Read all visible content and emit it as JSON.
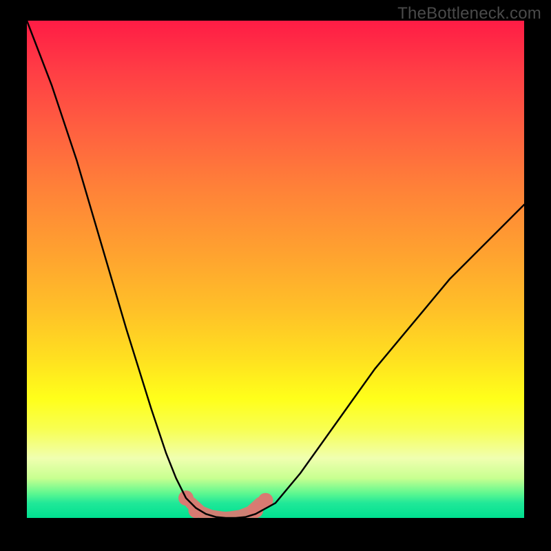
{
  "watermark": "TheBottleneck.com",
  "chart_data": {
    "type": "line",
    "title": "",
    "xlabel": "",
    "ylabel": "",
    "xlim": [
      0,
      100
    ],
    "ylim": [
      0,
      100
    ],
    "grid": false,
    "legend": false,
    "background_gradient": {
      "top": "#ff1c45",
      "mid": "#ffe020",
      "bottom": "#00e090"
    },
    "series": [
      {
        "name": "bottleneck-curve",
        "x": [
          0,
          5,
          10,
          15,
          20,
          25,
          28,
          30,
          32,
          34,
          36,
          38,
          40,
          42,
          44,
          46,
          50,
          55,
          60,
          65,
          70,
          75,
          80,
          85,
          90,
          95,
          100
        ],
        "values": [
          100,
          87,
          72,
          55,
          38,
          22,
          13,
          8,
          4,
          2,
          0.8,
          0.2,
          0,
          0,
          0.2,
          0.8,
          3,
          9,
          16,
          23,
          30,
          36,
          42,
          48,
          53,
          58,
          63
        ]
      },
      {
        "name": "ideal-range",
        "x": [
          33,
          35,
          37,
          39,
          40,
          41,
          43,
          45,
          47
        ],
        "values": [
          3,
          1.2,
          0.4,
          0.1,
          0,
          0.1,
          0.4,
          1.2,
          3
        ]
      }
    ],
    "annotations": [
      {
        "name": "marker-left-1",
        "x": 32,
        "y": 4
      },
      {
        "name": "marker-left-2",
        "x": 34,
        "y": 1.5
      },
      {
        "name": "marker-right-1",
        "x": 46,
        "y": 1.5
      },
      {
        "name": "marker-right-2",
        "x": 48,
        "y": 3.5
      }
    ]
  }
}
